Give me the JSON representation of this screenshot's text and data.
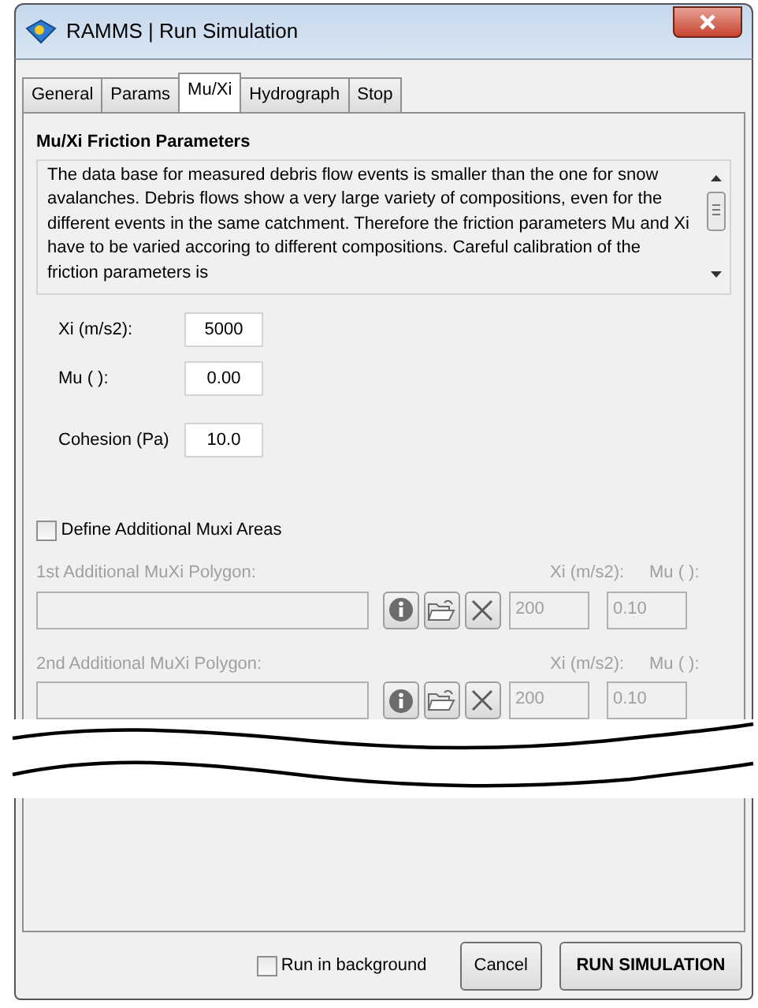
{
  "window": {
    "title": "RAMMS | Run Simulation"
  },
  "tabs": [
    {
      "label": "General",
      "selected": false
    },
    {
      "label": "Params",
      "selected": false
    },
    {
      "label": "Mu/Xi",
      "selected": true
    },
    {
      "label": "Hydrograph",
      "selected": false
    },
    {
      "label": "Stop",
      "selected": false
    }
  ],
  "section": {
    "heading": "Mu/Xi Friction Parameters",
    "description": "The data base for measured debris flow events is smaller than the one for snow avalanches. Debris flows show a very large variety of compositions, even for the different events in the same catchment. Therefore the friction parameters Mu and Xi have to be varied accoring to different compositions. Careful calibration of the friction parameters is"
  },
  "fields": [
    {
      "label": "Xi (m/s2):",
      "value": "5000"
    },
    {
      "label": "Mu ( ):",
      "value": "0.00"
    },
    {
      "label": "Cohesion (Pa)",
      "value": "10.0"
    }
  ],
  "define_areas": {
    "label": "Define Additional Muxi Areas",
    "checked": false
  },
  "polygons": [
    {
      "label": "1st Additional MuXi Polygon:",
      "disabled": true,
      "xi_label": "Xi (m/s2):",
      "xi_value": "200",
      "mu_label": "Mu ( ):",
      "mu_value": "0.10"
    },
    {
      "label": "2nd Additional MuXi Polygon:",
      "disabled": true,
      "xi_label": "Xi (m/s2):",
      "xi_value": "200",
      "mu_label": "Mu ( ):",
      "mu_value": "0.10"
    }
  ],
  "run_in_background": {
    "label": "Run in background",
    "checked": false
  },
  "buttons": [
    {
      "label": "Cancel",
      "kind": "normal"
    },
    {
      "label": "RUN SIMULATION",
      "kind": "primary"
    }
  ]
}
